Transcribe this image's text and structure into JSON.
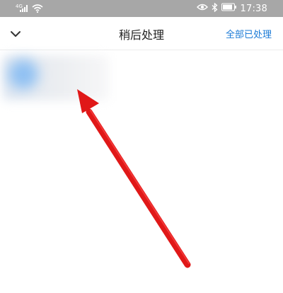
{
  "status_bar": {
    "time": "17:38",
    "icons": [
      "signal-icon",
      "wifi-icon",
      "eye-icon",
      "bluetooth-icon",
      "battery-icon"
    ]
  },
  "nav": {
    "title": "稍后处理",
    "action_label": "全部已处理",
    "back_icon": "chevron-down-icon"
  },
  "colors": {
    "status_bar_bg": "#a7a7a7",
    "accent": "#1a7ad6",
    "arrow": "#e01818"
  }
}
